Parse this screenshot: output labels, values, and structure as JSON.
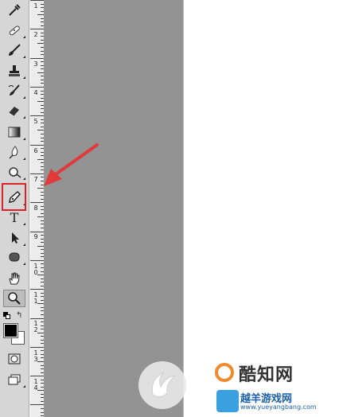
{
  "toolbar": {
    "tools": [
      {
        "name": "eyedropper-tool",
        "icon": "eyedropper-icon"
      },
      {
        "name": "healing-brush-tool",
        "icon": "bandage-icon"
      },
      {
        "name": "brush-tool",
        "icon": "brush-icon"
      },
      {
        "name": "clone-stamp-tool",
        "icon": "stamp-icon"
      },
      {
        "name": "history-brush-tool",
        "icon": "history-brush-icon"
      },
      {
        "name": "eraser-tool",
        "icon": "eraser-icon"
      },
      {
        "name": "gradient-tool",
        "icon": "gradient-icon"
      },
      {
        "name": "blur-tool",
        "icon": "drop-icon"
      },
      {
        "name": "dodge-tool",
        "icon": "dodge-icon"
      },
      {
        "name": "pen-tool",
        "icon": "pen-icon"
      },
      {
        "name": "type-tool",
        "icon": "type-icon",
        "label": "T"
      },
      {
        "name": "path-selection-tool",
        "icon": "arrow-icon"
      },
      {
        "name": "shape-tool",
        "icon": "rounded-rect-icon"
      },
      {
        "name": "hand-tool",
        "icon": "hand-icon"
      },
      {
        "name": "zoom-tool",
        "icon": "magnifier-icon"
      }
    ],
    "highlighted_tool": "pen-tool",
    "foreground_color": "#000000",
    "background_color": "#ffffff"
  },
  "ruler": {
    "labels": [
      "1",
      "2",
      "3",
      "4",
      "5",
      "6",
      "7",
      "8",
      "9",
      "1\n0",
      "1\n1",
      "1\n2",
      "1\n3",
      "1\n4"
    ]
  },
  "colors": {
    "canvas": "#939393",
    "highlight": "#d9232a",
    "arrow": "#e03a3a"
  },
  "watermark": {
    "title": "酷知网",
    "subtitle": "越羊游戏网",
    "url": "www.yueyangbang.com"
  }
}
